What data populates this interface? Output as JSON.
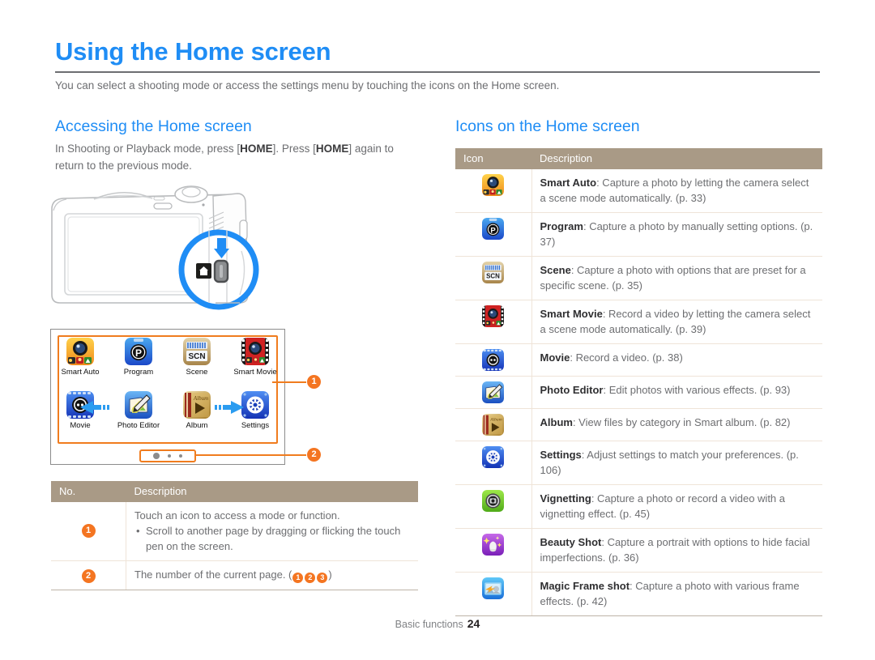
{
  "header": {
    "title": "Using the Home screen",
    "intro": "You can select a shooting mode or access the settings menu by touching the icons on the Home screen."
  },
  "left_section": {
    "heading": "Accessing the Home screen",
    "body_pre": "In Shooting or Playback mode, press [",
    "body_key1": "HOME",
    "body_mid": "]. Press [",
    "body_key2": "HOME",
    "body_post": "] again to return to the previous mode."
  },
  "home_mock": {
    "row1": [
      {
        "label": "Smart Auto",
        "icon": "smart-auto-icon"
      },
      {
        "label": "Program",
        "icon": "program-icon"
      },
      {
        "label": "Scene",
        "icon": "scene-icon"
      },
      {
        "label": "Smart Movie",
        "icon": "smart-movie-icon"
      }
    ],
    "row2": [
      {
        "label": "Movie",
        "icon": "movie-icon"
      },
      {
        "label": "Photo Editor",
        "icon": "photo-editor-icon"
      },
      {
        "label": "Album",
        "icon": "album-icon"
      },
      {
        "label": "Settings",
        "icon": "settings-icon"
      }
    ],
    "scene_text": "SCN",
    "album_text": "Album",
    "callout_1": "1",
    "callout_2": "2"
  },
  "left_table": {
    "headers": [
      "No.",
      "Description"
    ],
    "rows": [
      {
        "no": "1",
        "line1": "Touch an icon to access a mode or function.",
        "bullets": [
          "Scroll to another page by dragging or flicking the touch pen on the screen."
        ]
      },
      {
        "no": "2",
        "line1_pre": "The number of the current page. (",
        "badges": [
          "1",
          "2",
          "3"
        ],
        "line1_post": ")"
      }
    ]
  },
  "right_section": {
    "heading": "Icons on the Home screen"
  },
  "right_table": {
    "headers": [
      "Icon",
      "Description"
    ],
    "rows": [
      {
        "icon": "smart-auto-icon",
        "name": "Smart Auto",
        "desc": ": Capture a photo by letting the camera select a scene mode automatically. (p. 33)"
      },
      {
        "icon": "program-icon",
        "name": "Program",
        "desc": ": Capture a photo by manually setting options. (p. 37)"
      },
      {
        "icon": "scene-icon",
        "name": "Scene",
        "desc": ": Capture a photo with options that are preset for a specific scene. (p. 35)"
      },
      {
        "icon": "smart-movie-icon",
        "name": "Smart Movie",
        "desc": ": Record a video by letting the camera select a scene mode automatically. (p. 39)"
      },
      {
        "icon": "movie-icon",
        "name": "Movie",
        "desc": ": Record a video. (p. 38)"
      },
      {
        "icon": "photo-editor-icon",
        "name": "Photo Editor",
        "desc": ": Edit photos with various effects. (p. 93)"
      },
      {
        "icon": "album-icon",
        "name": "Album",
        "desc": ": View files by category in Smart album. (p. 82)"
      },
      {
        "icon": "settings-icon",
        "name": "Settings",
        "desc": ": Adjust settings to match your preferences. (p. 106)"
      },
      {
        "icon": "vignetting-icon",
        "name": "Vignetting",
        "desc": ": Capture a photo or record a video with a vignetting effect. (p. 45)"
      },
      {
        "icon": "beauty-shot-icon",
        "name": "Beauty Shot",
        "desc": ": Capture a portrait with options to hide facial imperfections. (p. 36)"
      },
      {
        "icon": "magic-frame-icon",
        "name": "Magic Frame shot",
        "desc": ": Capture a photo with various frame effects. (p. 42)"
      }
    ]
  },
  "footer": {
    "label": "Basic functions",
    "page": "24"
  },
  "colors": {
    "accent_blue": "#1f8df5",
    "table_header": "#a99a86",
    "callout_orange": "#f47521",
    "body_gray": "#6d6e71"
  }
}
